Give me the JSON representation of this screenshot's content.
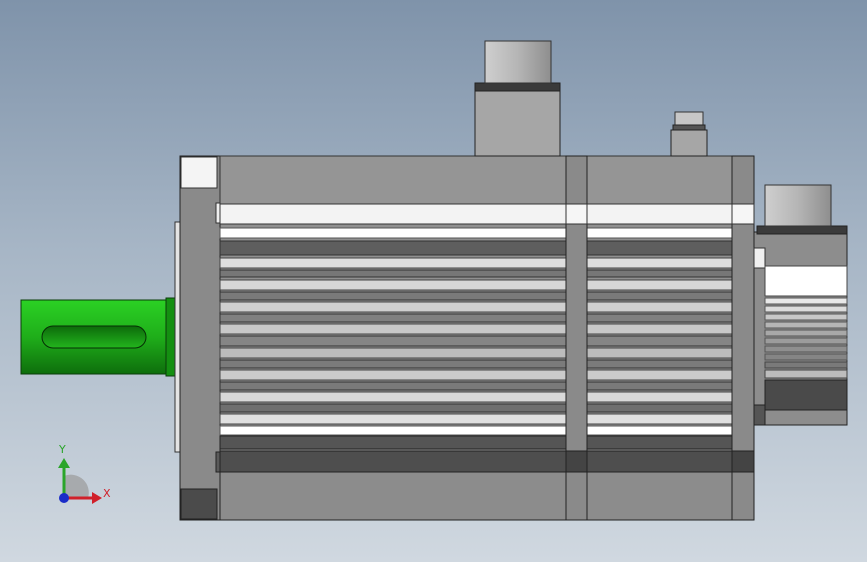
{
  "viewport": {
    "background_top": "#7f93aa",
    "background_bottom": "#d0d8e0"
  },
  "model": {
    "shaft_color": "#1fae1a",
    "body_color": "#8c8c8c",
    "connector_color": "#a9a9a9",
    "stripe_color": "#e6e6e6"
  },
  "triad": {
    "x_label": "X",
    "y_label": "Y",
    "x_color": "#d0202a",
    "y_color": "#2aa52a",
    "z_color": "#1a2cc8"
  }
}
